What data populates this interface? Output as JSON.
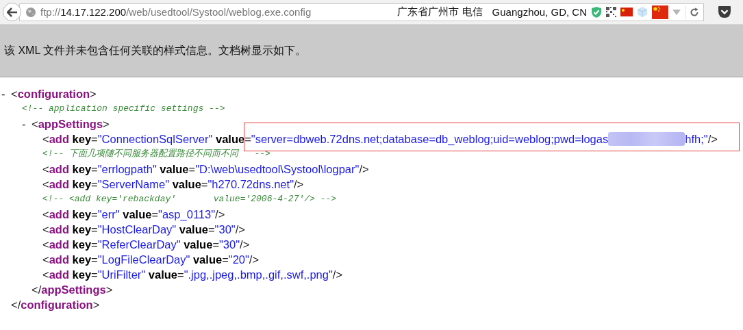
{
  "browser": {
    "url": {
      "scheme": "ftp://",
      "host": "14.17.122.200",
      "path": "/web/usedtool/Systool/weblog.exe.config"
    },
    "location": [
      "广东省广州市 电信",
      "Guangzhou, GD, CN"
    ]
  },
  "notice": "该 XML 文件并未包含任何关联的样式信息。文档树显示如下。",
  "syntax": {
    "lt": "<",
    "gt": ">",
    "slash": "/",
    "eq": "=",
    "quote": "\""
  },
  "document": {
    "kind": "element",
    "toggle": "-",
    "tag": "configuration",
    "children": [
      {
        "kind": "comment",
        "text": "<!-- application specific settings -->"
      },
      {
        "kind": "element",
        "toggle": "-",
        "tag": "appSettings",
        "children": [
          {
            "kind": "empty",
            "tag": "add",
            "highlighted": true,
            "attributes": [
              {
                "name": "key",
                "value": "ConnectionSqlServer"
              },
              {
                "name": "value",
                "value": "server=dbweb.72dns.net;database=db_weblog;uid=weblog;pwd=logas",
                "redacted": true,
                "value_tail": "hfh;"
              }
            ]
          },
          {
            "kind": "comment",
            "text": "<!-- 下面几项随不同服务器配置路径不同而不同   -->"
          },
          {
            "kind": "empty",
            "tag": "add",
            "attributes": [
              {
                "name": "key",
                "value": "errlogpath"
              },
              {
                "name": "value",
                "value": "D:\\web\\usedtool\\Systool\\logpar"
              }
            ]
          },
          {
            "kind": "empty",
            "tag": "add",
            "attributes": [
              {
                "name": "key",
                "value": "ServerName"
              },
              {
                "name": "value",
                "value": "h270.72dns.net"
              }
            ]
          },
          {
            "kind": "comment",
            "text": "<!-- <add key='rebackday'       value='2006-4-27'/> -->"
          },
          {
            "kind": "empty",
            "tag": "add",
            "attributes": [
              {
                "name": "key",
                "value": "err"
              },
              {
                "name": "value",
                "value": "asp_0113"
              }
            ]
          },
          {
            "kind": "empty",
            "tag": "add",
            "attributes": [
              {
                "name": "key",
                "value": "HostClearDay"
              },
              {
                "name": "value",
                "value": "30"
              }
            ]
          },
          {
            "kind": "empty",
            "tag": "add",
            "attributes": [
              {
                "name": "key",
                "value": "ReferClearDay"
              },
              {
                "name": "value",
                "value": "30"
              }
            ]
          },
          {
            "kind": "empty",
            "tag": "add",
            "attributes": [
              {
                "name": "key",
                "value": "LogFileClearDay"
              },
              {
                "name": "value",
                "value": "20"
              }
            ]
          },
          {
            "kind": "empty",
            "tag": "add",
            "attributes": [
              {
                "name": "key",
                "value": "UriFilter"
              },
              {
                "name": "value",
                "value": ".jpg,.jpeg,.bmp,.gif,.swf,.png"
              }
            ]
          }
        ],
        "closing_tag": "appSettings"
      }
    ],
    "closing_tag": "configuration"
  }
}
